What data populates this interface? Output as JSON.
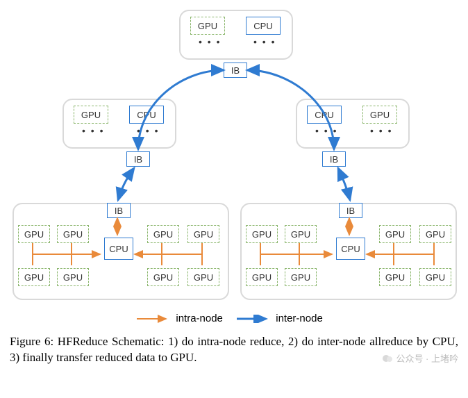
{
  "labels": {
    "gpu": "GPU",
    "cpu": "CPU",
    "ib": "IB",
    "dots": "• • •"
  },
  "legend": {
    "intra": "intra-node",
    "inter": "inter-node"
  },
  "colors": {
    "intra": "#e98a3a",
    "inter": "#2f7bd1",
    "gpu_border": "#89b56a",
    "group_border": "#d9d9d9"
  },
  "caption": "Figure 6: HFReduce Schematic: 1) do intra-node reduce, 2) do inter-node allreduce by CPU, 3) finally transfer reduced data to GPU.",
  "watermark": "公众号 · 上堵吟",
  "chart_data": {
    "type": "diagram",
    "title": "HFReduce Schematic",
    "tree_levels": 3,
    "nodes": [
      {
        "id": "root",
        "level": 0,
        "children": [
          "mid_left",
          "mid_right"
        ],
        "components": [
          "GPU...",
          "CPU...",
          "IB"
        ]
      },
      {
        "id": "mid_left",
        "level": 1,
        "children": [
          "leaf_left"
        ],
        "components": [
          "GPU...",
          "CPU...",
          "IB"
        ]
      },
      {
        "id": "mid_right",
        "level": 1,
        "children": [
          "leaf_right"
        ],
        "components": [
          "CPU...",
          "GPU...",
          "IB"
        ]
      },
      {
        "id": "leaf_left",
        "level": 2,
        "components": [
          "GPU×8",
          "CPU",
          "IB"
        ]
      },
      {
        "id": "leaf_right",
        "level": 2,
        "components": [
          "GPU×8",
          "CPU",
          "IB"
        ]
      }
    ],
    "edges": [
      {
        "from": "root.IB",
        "to": "mid_left.IB",
        "kind": "inter-node",
        "bidir": true
      },
      {
        "from": "root.IB",
        "to": "mid_right.IB",
        "kind": "inter-node",
        "bidir": true
      },
      {
        "from": "mid_left.IB",
        "to": "leaf_left.IB",
        "kind": "inter-node",
        "bidir": true
      },
      {
        "from": "mid_right.IB",
        "to": "leaf_right.IB",
        "kind": "inter-node",
        "bidir": true
      },
      {
        "from": "leaf_left.CPU",
        "to": "leaf_left.IB",
        "kind": "intra-node",
        "bidir": true
      },
      {
        "from": "leaf_right.CPU",
        "to": "leaf_right.IB",
        "kind": "intra-node",
        "bidir": true
      },
      {
        "from": "leaf_left.GPU[*]",
        "to": "leaf_left.CPU",
        "kind": "intra-node",
        "bidir": false
      },
      {
        "from": "leaf_right.GPU[*]",
        "to": "leaf_right.CPU",
        "kind": "intra-node",
        "bidir": false
      }
    ],
    "steps": [
      "1) do intra-node reduce",
      "2) do inter-node allreduce by CPU",
      "3) finally transfer reduced data to GPU"
    ]
  }
}
